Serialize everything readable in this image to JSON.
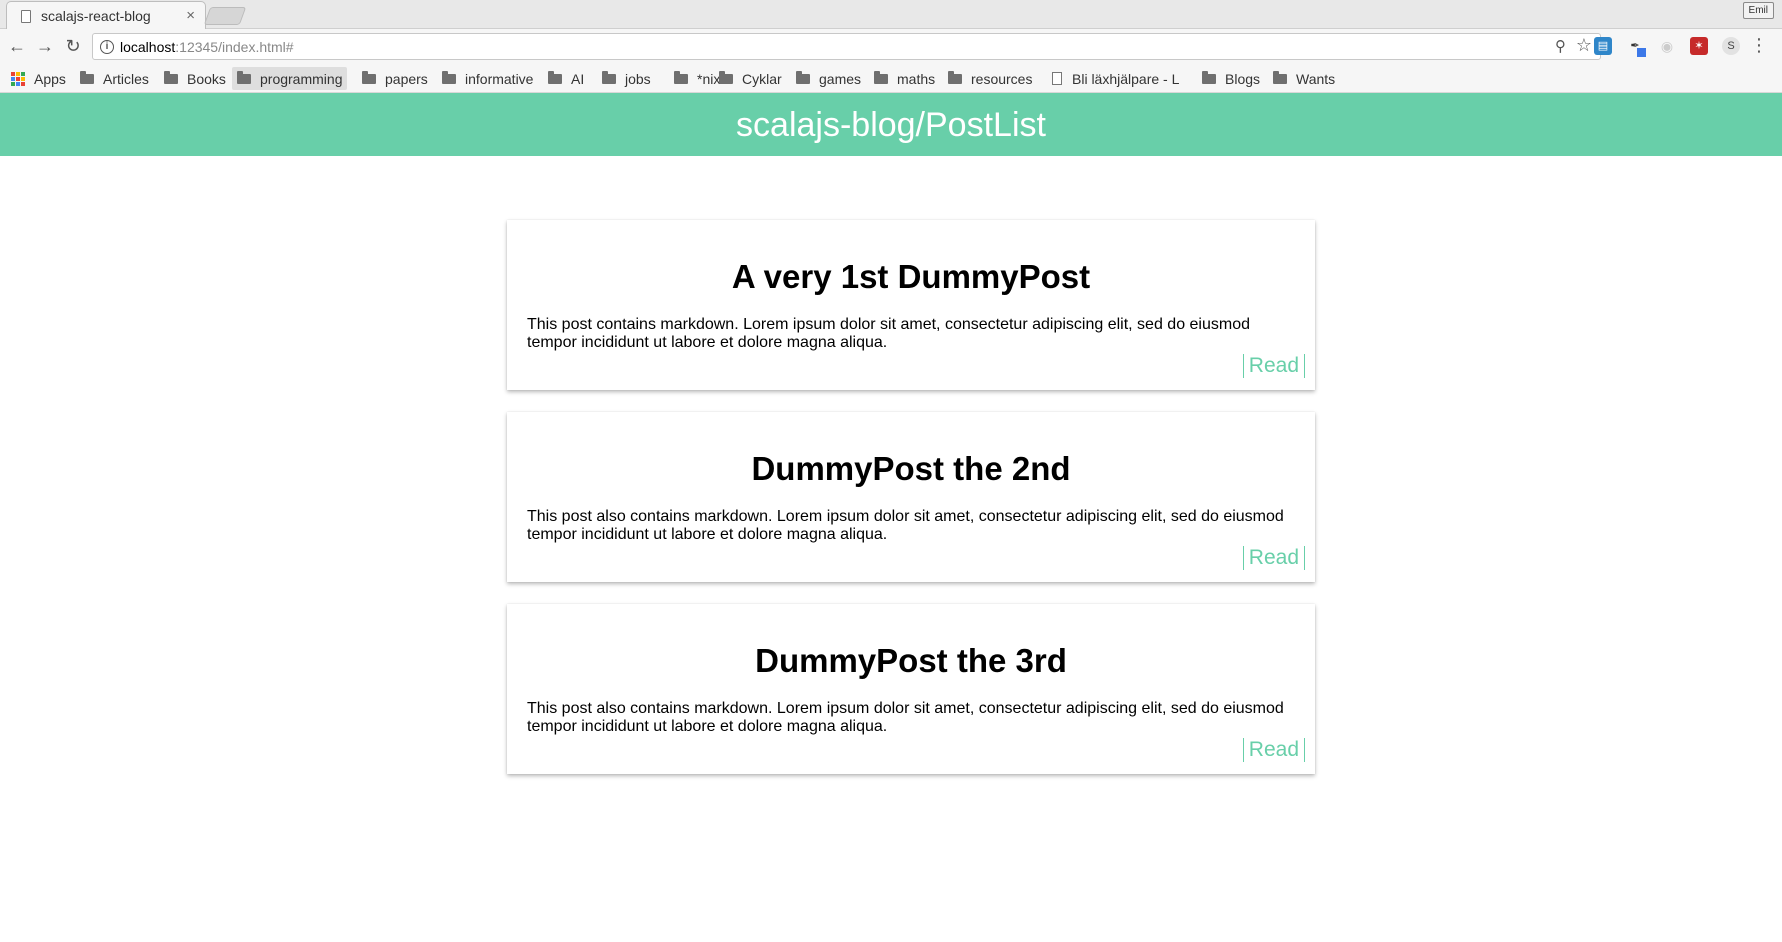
{
  "browser": {
    "tab": {
      "title": "scalajs-react-blog",
      "close_glyph": "×"
    },
    "window_badge": "Emil",
    "url": {
      "host": "localhost",
      "rest": ":12345/index.html#"
    },
    "nav": {
      "back_glyph": "←",
      "forward_glyph": "→",
      "reload_glyph": "↻"
    },
    "bookmarks": [
      {
        "label": "Apps",
        "icon": "apps-icon"
      },
      {
        "label": "Articles",
        "icon": "folder-icon"
      },
      {
        "label": "Books",
        "icon": "folder-icon"
      },
      {
        "label": "programming",
        "icon": "folder-icon",
        "active": true
      },
      {
        "label": "papers",
        "icon": "folder-icon"
      },
      {
        "label": "informative",
        "icon": "folder-icon"
      },
      {
        "label": "AI",
        "icon": "folder-icon"
      },
      {
        "label": "jobs",
        "icon": "folder-icon"
      },
      {
        "label": "*nix",
        "icon": "folder-icon"
      },
      {
        "label": "Cyklar",
        "icon": "folder-icon"
      },
      {
        "label": "games",
        "icon": "folder-icon"
      },
      {
        "label": "maths",
        "icon": "folder-icon"
      },
      {
        "label": "resources",
        "icon": "folder-icon"
      },
      {
        "label": "Bli läxhjälpare - L",
        "icon": "page-icon"
      },
      {
        "label": "Blogs",
        "icon": "folder-icon"
      },
      {
        "label": "Wants",
        "icon": "folder-icon"
      }
    ],
    "extensions": [
      "reader-extension-icon",
      "eyedropper-extension-icon",
      "ghost-extension-icon",
      "red-extension-icon",
      "s-extension-icon"
    ],
    "extension_s_label": "S"
  },
  "header": {
    "title": "scalajs-blog/PostList",
    "color": "#68cfa9"
  },
  "posts": [
    {
      "title": "A very 1st DummyPost",
      "body": "This post contains markdown. Lorem ipsum dolor sit amet, consectetur adipiscing elit, sed do eiusmod tempor incididunt ut labore et dolore magna aliqua.",
      "read_label": "Read"
    },
    {
      "title": "DummyPost the 2nd",
      "body": "This post also contains markdown. Lorem ipsum dolor sit amet, consectetur adipiscing elit, sed do eiusmod tempor incididunt ut labore et dolore magna aliqua.",
      "read_label": "Read"
    },
    {
      "title": "DummyPost the 3rd",
      "body": "This post also contains markdown. Lorem ipsum dolor sit amet, consectetur adipiscing elit, sed do eiusmod tempor incididunt ut labore et dolore magna aliqua.",
      "read_label": "Read"
    }
  ]
}
